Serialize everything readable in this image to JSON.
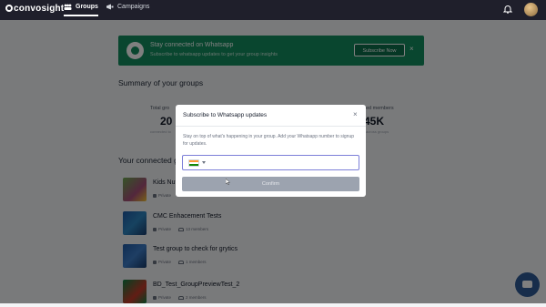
{
  "app": {
    "logo": "convosight"
  },
  "nav": {
    "groups_label": "Groups",
    "campaigns_label": "Campaigns"
  },
  "banner": {
    "title": "Stay connected on Whatsapp",
    "subtitle": "Subscribe to whatsapp updates to get your group insights",
    "button": "Subscribe Now",
    "close": "×"
  },
  "summary": {
    "heading": "Summary of your groups",
    "total_label": "Total gro",
    "total_value": "20",
    "total_foot": "connected to",
    "right_label": "ed members",
    "right_value": "45K",
    "right_foot": "across groups"
  },
  "connected": {
    "heading": "Your connected g",
    "groups": [
      {
        "name": "Kids Nut",
        "privacy": "Private",
        "members": ""
      },
      {
        "name": "CMC Enhacement Tests",
        "privacy": "Private",
        "members": "13 members"
      },
      {
        "name": "Test group to check for grytics",
        "privacy": "Private",
        "members": "1 members"
      },
      {
        "name": "BD_Test_GroupPreviewTest_2",
        "privacy": "Private",
        "members": "2 members"
      }
    ]
  },
  "modal": {
    "title": "Subscribe to Whatsapp updates",
    "close": "×",
    "description": "Stay on top of what's happening in your group. Add your Whatsapp number to signup for updates.",
    "phone_value": "",
    "confirm": "Confirm",
    "country_icon": "india-flag-icon"
  },
  "colors": {
    "topbar": "#1f1f2b",
    "banner": "#128c5e",
    "phone_border": "#7c7fd8",
    "confirm_disabled": "#9ca3af",
    "chat_button": "#2f5b96"
  }
}
